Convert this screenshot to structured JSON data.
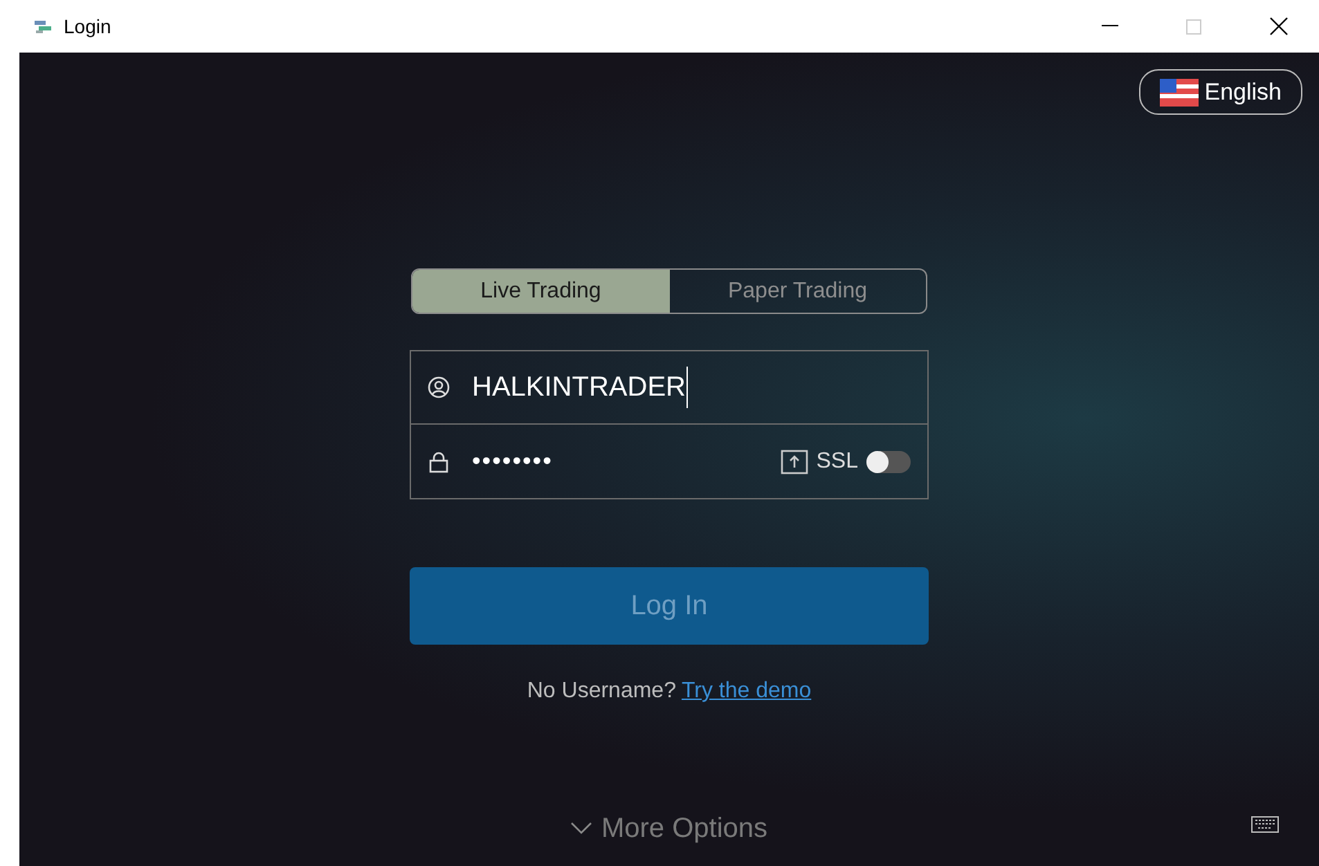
{
  "window": {
    "title": "Login"
  },
  "language": {
    "label": "English"
  },
  "tabs": [
    {
      "label": "Live Trading",
      "selected": true
    },
    {
      "label": "Paper Trading",
      "selected": false
    }
  ],
  "username": {
    "value": "HALKINTRADER"
  },
  "password": {
    "value": "••••••••",
    "ssl_label": "SSL",
    "ssl_on": false
  },
  "login_button": {
    "label": "Log In",
    "disabled": true
  },
  "demo": {
    "prompt": "No Username?",
    "link": "Try the demo"
  },
  "more_options": {
    "label": "More Options",
    "expanded": false
  }
}
